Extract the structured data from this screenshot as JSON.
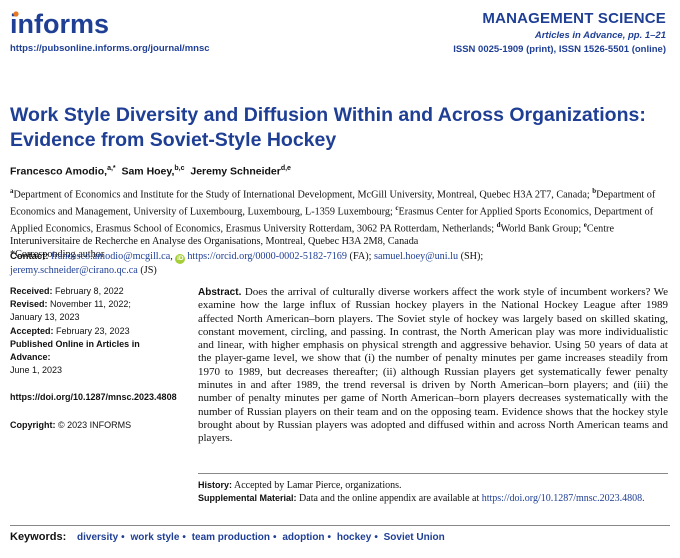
{
  "header": {
    "logo_text": "informs",
    "journal_url": "https://pubsonline.informs.org/journal/mnsc",
    "journal_name": "MANAGEMENT SCIENCE",
    "journal_sub": "Articles in Advance, pp. 1–21",
    "issn": "ISSN 0025-1909 (print), ISSN 1526-5501 (online)",
    "brand_color": "#1f3f95",
    "logo_dot_color": "#e87722"
  },
  "title": "Work Style Diversity and Diffusion Within and Across Organizations: Evidence from Soviet-Style Hockey",
  "authors": [
    {
      "name": "Francesco Amodio,",
      "sup": "a,*"
    },
    {
      "name": "Sam Hoey,",
      "sup": "b,c"
    },
    {
      "name": "Jeremy Schneider",
      "sup": "d,e"
    }
  ],
  "affiliations": [
    {
      "sup": "a",
      "text": "Department of Economics and Institute for the Study of International Development, McGill University, Montreal, Quebec H3A 2T7, Canada;"
    },
    {
      "sup": "b",
      "text": "Department of Economics and Management, University of Luxembourg, Luxembourg, L-1359 Luxembourg;"
    },
    {
      "sup": "c",
      "text": "Erasmus Center for Applied Sports Economics, Department of Applied Economics, Erasmus School of Economics, Erasmus University Rotterdam, 3062 PA Rotterdam, Netherlands;"
    },
    {
      "sup": "d",
      "text": "World Bank Group;"
    },
    {
      "sup": "e",
      "text": "Centre Interuniversitaire de Recherche en Analyse des Organisations, Montreal, Quebec H3A 2M8, Canada"
    }
  ],
  "corresponding": "*Corresponding author",
  "contact": {
    "label": "Contact:",
    "email1": "francesco.amodio@mcgill.ca",
    "orcid": "https://orcid.org/0000-0002-5182-7169",
    "orcid_badge": "iD",
    "fa": "(FA);",
    "email2": "samuel.hoey@uni.lu",
    "sh": "(SH);",
    "email3": "jeremy.schneider@cirano.qc.ca",
    "js": "(JS)"
  },
  "history": {
    "received_label": "Received:",
    "received": "February 8, 2022",
    "revised_label": "Revised:",
    "revised_1": "November 11, 2022;",
    "revised_2": "January 13, 2023",
    "accepted_label": "Accepted:",
    "accepted": "February 23, 2023",
    "published_label": "Published Online in Articles in Advance:",
    "published": "June 1, 2023",
    "doi": "https://doi.org/10.1287/mnsc.2023.4808",
    "copyright_label": "Copyright:",
    "copyright": "© 2023 INFORMS"
  },
  "abstract": {
    "label": "Abstract.",
    "text": "Does the arrival of culturally diverse workers affect the work style of incumbent workers? We examine how the large influx of Russian hockey players in the National Hockey League after 1989 affected North American–born players. The Soviet style of hockey was largely based on skilled skating, constant movement, circling, and passing. In contrast, the North American play was more individualistic and linear, with higher emphasis on physical strength and aggressive behavior. Using 50 years of data at the player-game level, we show that (i) the number of penalty minutes per game increases steadily from 1970 to 1989, but decreases thereafter; (ii) although Russian players get systematically fewer penalty minutes in and after 1989, the trend reversal is driven by North American–born players; and (iii) the number of penalty minutes per game of North American–born players decreases systematically with the number of Russian players on their team and on the opposing team. Evidence shows that the hockey style brought about by Russian players was adopted and diffused within and across North American teams and players."
  },
  "article_history": {
    "label": "History:",
    "text": "Accepted by Lamar Pierce, organizations.",
    "supp_label": "Supplemental Material:",
    "supp_text": "Data and the online appendix are available at",
    "supp_link": "https://doi.org/10.1287/mnsc.2023.4808."
  },
  "keywords": {
    "label": "Keywords:",
    "items": [
      "diversity",
      "work style",
      "team production",
      "adoption",
      "hockey",
      "Soviet Union"
    ],
    "separator": "•"
  }
}
